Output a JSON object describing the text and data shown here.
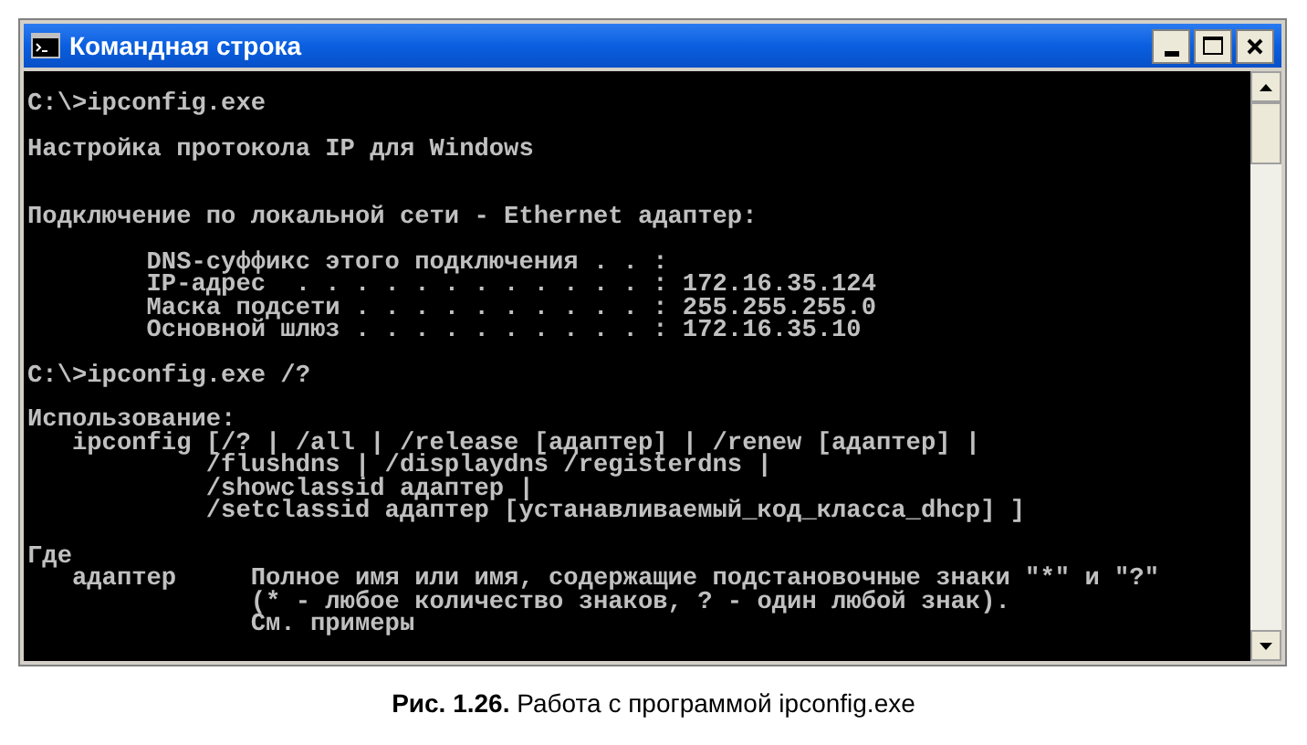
{
  "window": {
    "title": "Командная строка"
  },
  "console": {
    "lines": [
      {
        "kind": "text",
        "text": "C:\\>ipconfig.exe"
      },
      {
        "kind": "blank"
      },
      {
        "kind": "text",
        "text": "Настройка протокола IP для Windows"
      },
      {
        "kind": "blank"
      },
      {
        "kind": "blank"
      },
      {
        "kind": "text",
        "text": "Подключение по локальной сети - Ethernet адаптер:"
      },
      {
        "kind": "blank"
      },
      {
        "kind": "text",
        "text": "        DNS-суффикс этого подключения . . :"
      },
      {
        "kind": "text",
        "text": "        IP-адрес  . . . . . . . . . . . . : 172.16.35.124"
      },
      {
        "kind": "text",
        "text": "        Маска подсети . . . . . . . . . . : 255.255.255.0"
      },
      {
        "kind": "text",
        "text": "        Основной шлюз . . . . . . . . . . : 172.16.35.10"
      },
      {
        "kind": "blank"
      },
      {
        "kind": "text",
        "text": "C:\\>ipconfig.exe /?"
      },
      {
        "kind": "blank"
      },
      {
        "kind": "text",
        "text": "Использование:"
      },
      {
        "kind": "text",
        "text": "   ipconfig [/? | /all | /release [адаптер] | /renew [адаптер] |"
      },
      {
        "kind": "text",
        "text": "            /flushdns | /displaydns /registerdns |"
      },
      {
        "kind": "text",
        "text": "            /showclassid адаптер |"
      },
      {
        "kind": "text",
        "text": "            /setclassid адаптер [устанавливаемый_код_класса_dhcp] ]"
      },
      {
        "kind": "blank"
      },
      {
        "kind": "text",
        "text": "Где"
      },
      {
        "kind": "text",
        "text": "   адаптер     Полное имя или имя, содержащие подстановочные знаки \"*\" и \"?\""
      },
      {
        "kind": "text",
        "text": "               (* - любое количество знаков, ? - один любой знак)."
      },
      {
        "kind": "text",
        "text": "               См. примеры"
      }
    ]
  },
  "caption": "**Рис. 1.26.** Работа с программой ipconfig.exe"
}
